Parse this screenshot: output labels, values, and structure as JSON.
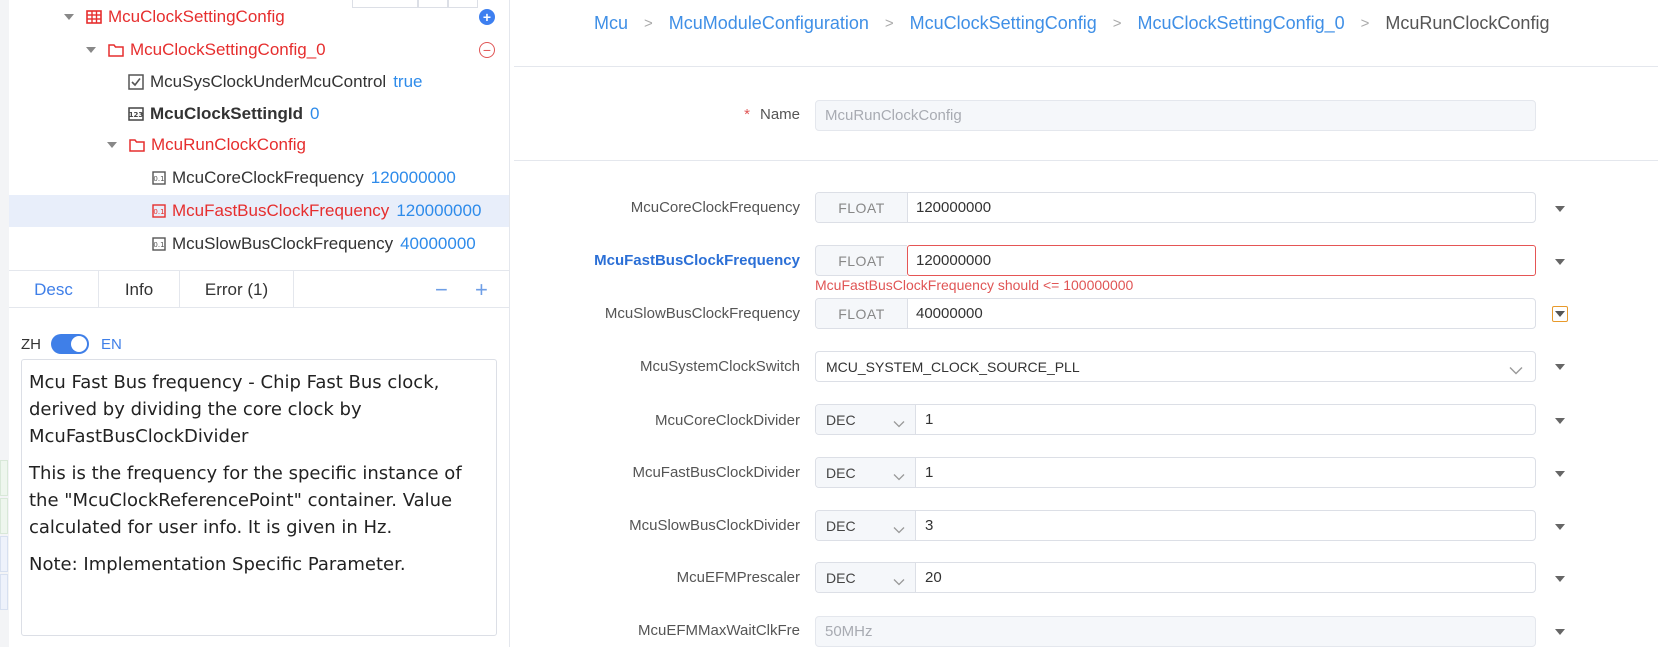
{
  "tree": {
    "nodes": [
      {
        "label": "McuClockSettingConfig",
        "value": "",
        "icon": "table-icon",
        "style": "red"
      },
      {
        "label": "McuClockSettingConfig_0",
        "value": "",
        "icon": "folder-icon",
        "style": "red"
      },
      {
        "label": "McuSysClockUnderMcuControl",
        "value": "true",
        "icon": "checkbox-icon",
        "style": "normal"
      },
      {
        "label": "McuClockSettingId",
        "value": "0",
        "icon": "integer-icon",
        "style": "bold"
      },
      {
        "label": "McuRunClockConfig",
        "value": "",
        "icon": "folder-icon",
        "style": "red"
      },
      {
        "label": "McuCoreClockFrequency",
        "value": "120000000",
        "icon": "float-icon",
        "style": "normal"
      },
      {
        "label": "McuFastBusClockFrequency",
        "value": "120000000",
        "icon": "float-icon",
        "style": "red"
      },
      {
        "label": "McuSlowBusClockFrequency",
        "value": "40000000",
        "icon": "float-icon",
        "style": "normal"
      }
    ]
  },
  "detail": {
    "tabs": [
      "Desc",
      "Info",
      "Error (1)"
    ],
    "lang_zh": "ZH",
    "lang_en": "EN",
    "paragraphs": [
      "Mcu Fast Bus frequency - Chip Fast Bus clock, derived by dividing the core clock by McuFastBusClockDivider",
      "This is the frequency for the specific instance of the \"McuClockReferencePoint\" container. Value calculated for user info. It is given in Hz.",
      "Note: Implementation Specific Parameter."
    ]
  },
  "breadcrumb": [
    "Mcu",
    "McuModuleConfiguration",
    "McuClockSettingConfig",
    "McuClockSettingConfig_0",
    "McuRunClockConfig"
  ],
  "form": {
    "name_label": "Name",
    "required_mark": "*",
    "name_value": "McuRunClockConfig",
    "float_fields": [
      {
        "label": "McuCoreClockFrequency",
        "type": "FLOAT",
        "value": "120000000"
      },
      {
        "label": "McuFastBusClockFrequency",
        "type": "FLOAT",
        "value": "120000000"
      },
      {
        "label": "McuSlowBusClockFrequency",
        "type": "FLOAT",
        "value": "40000000"
      }
    ],
    "error_message": "McuFastBusClockFrequency should <= 100000000",
    "switch_field": {
      "label": "McuSystemClockSwitch",
      "value": "MCU_SYSTEM_CLOCK_SOURCE_PLL"
    },
    "divider_fields": [
      {
        "label": "McuCoreClockDivider",
        "format": "DEC",
        "value": "1"
      },
      {
        "label": "McuFastBusClockDivider",
        "format": "DEC",
        "value": "1"
      },
      {
        "label": "McuSlowBusClockDivider",
        "format": "DEC",
        "value": "3"
      },
      {
        "label": "McuEFMPrescaler",
        "format": "DEC",
        "value": "20"
      }
    ],
    "wait_field": {
      "label": "McuEFMMaxWaitClkFre",
      "value": "50MHz"
    }
  },
  "colors": {
    "accent": "#3f7fe8",
    "error": "#e05555",
    "tree_red": "#e62e2e",
    "value_blue": "#2e8bea"
  }
}
